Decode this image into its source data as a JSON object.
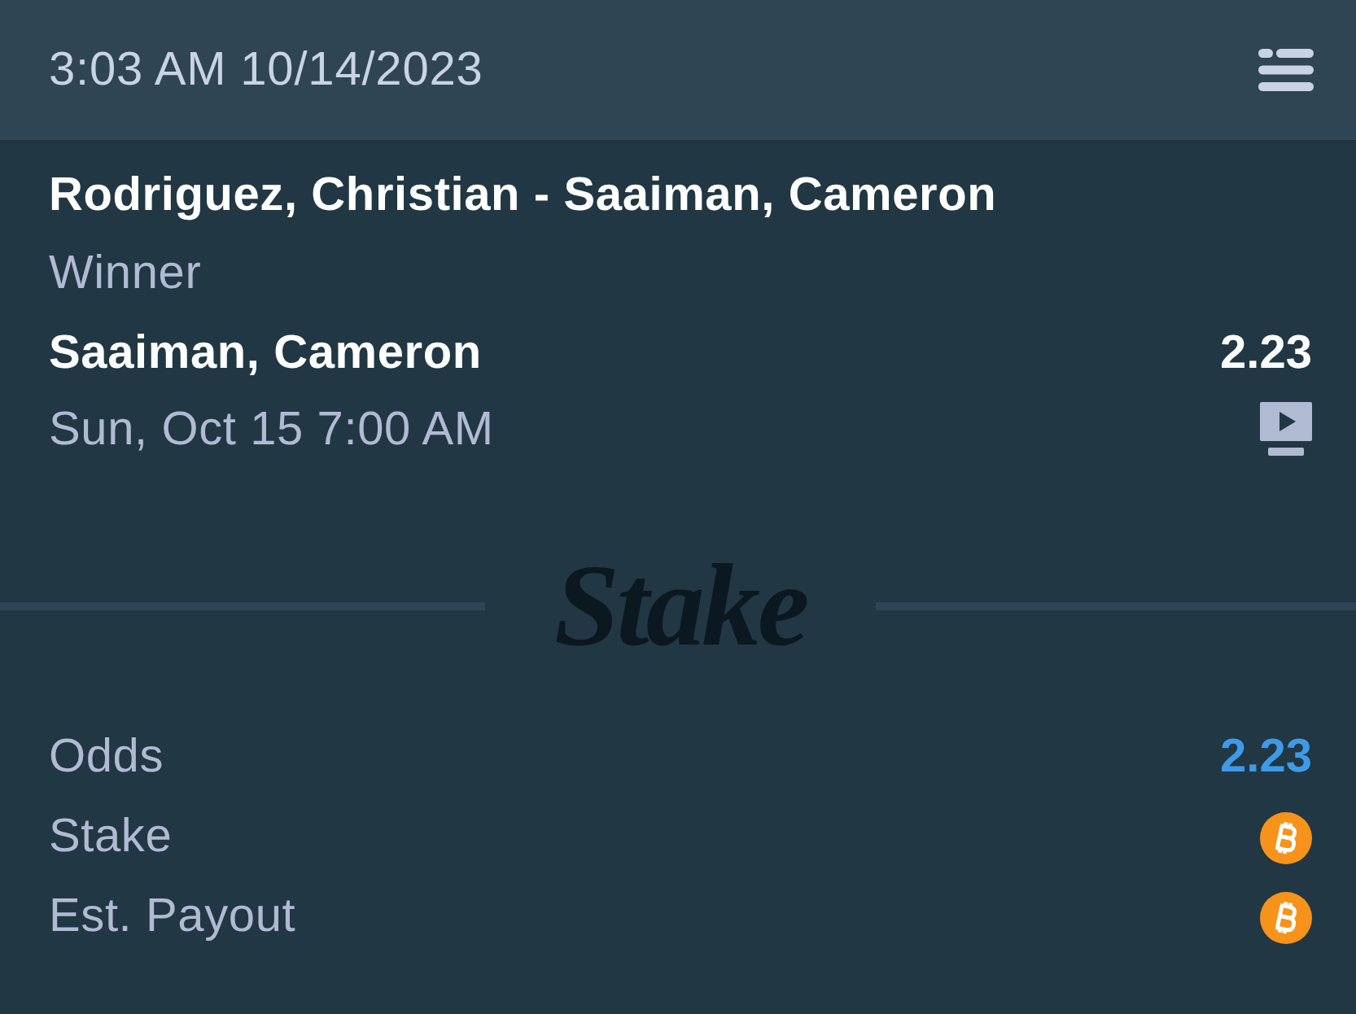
{
  "header": {
    "timestamp": "3:03 AM 10/14/2023"
  },
  "bet": {
    "event": "Rodriguez, Christian - Saaiman, Cameron",
    "market": "Winner",
    "selection": "Saaiman, Cameron",
    "odds": "2.23",
    "start_time": "Sun, Oct 15 7:00 AM"
  },
  "divider": {
    "logo": "Stake"
  },
  "summary": [
    {
      "label": "Odds",
      "kind": "text",
      "value": "2.23"
    },
    {
      "label": "Stake",
      "kind": "currency"
    },
    {
      "label": "Est. Payout",
      "kind": "currency"
    }
  ]
}
